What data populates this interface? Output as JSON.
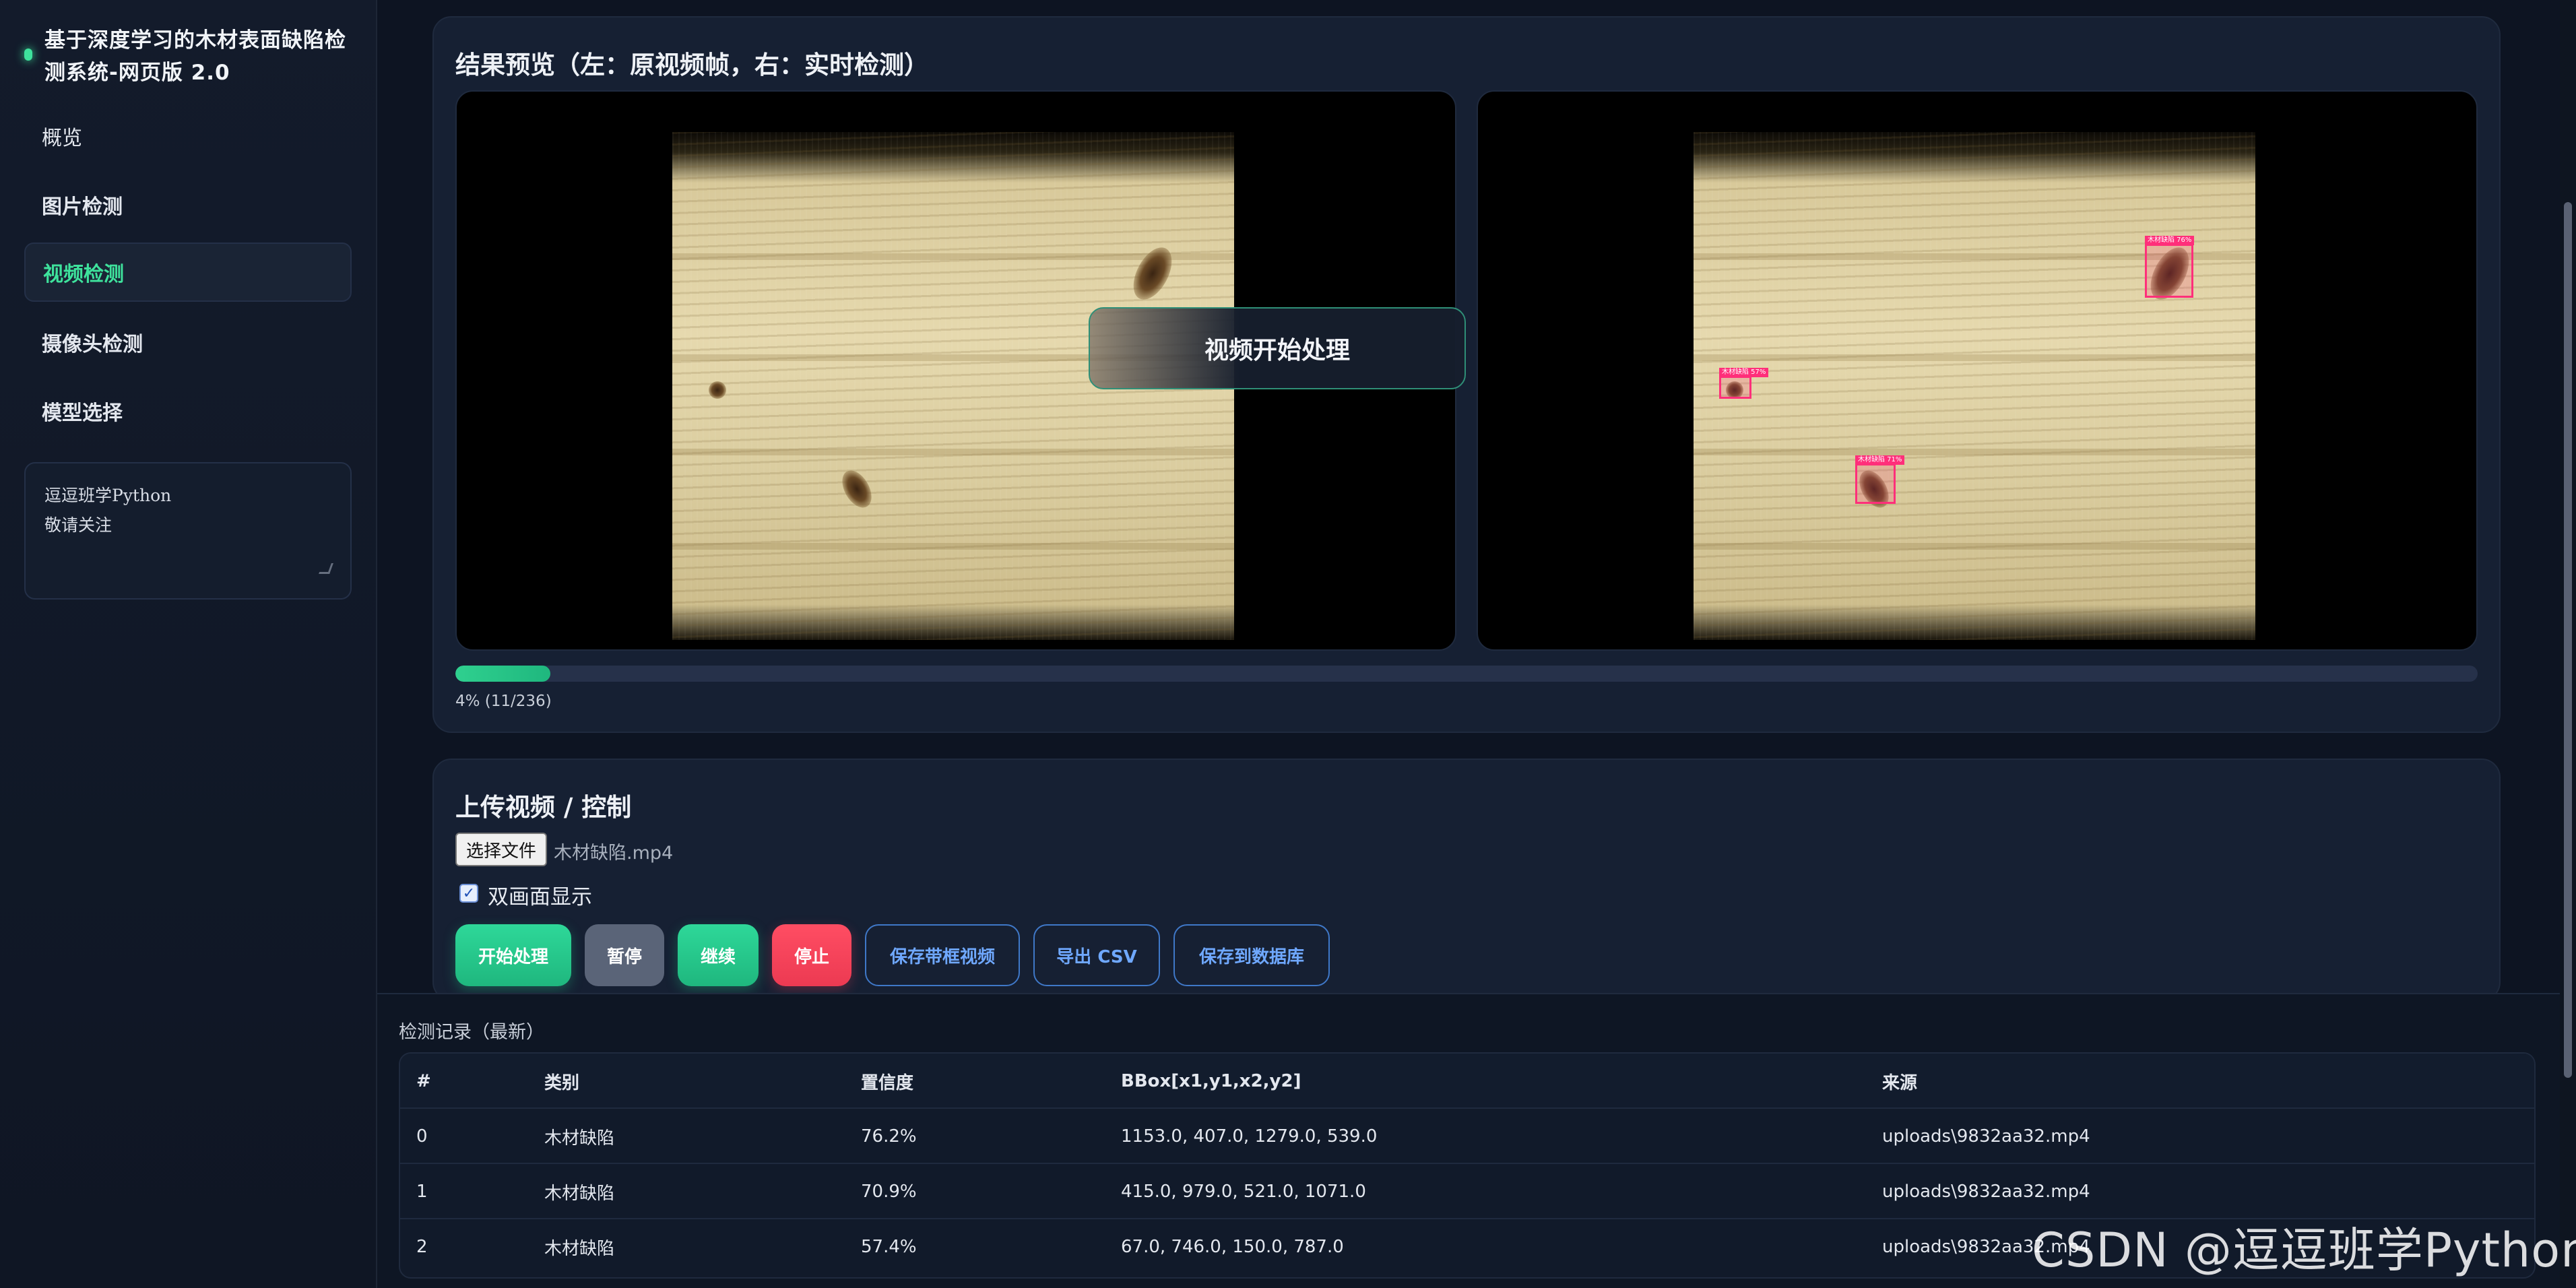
{
  "sidebar": {
    "brand": "基于深度学习的木材表面缺陷检测系统-网页版 2.0",
    "items": [
      {
        "label": "概览"
      },
      {
        "label": "图片检测"
      },
      {
        "label": "视频检测"
      },
      {
        "label": "摄像头检测"
      },
      {
        "label": "模型选择"
      }
    ],
    "notes": "逗逗班学Python\n敬请关注"
  },
  "preview": {
    "title": "结果预览（左：原视频帧，右：实时检测）",
    "overlay": "视频开始处理",
    "progress_fraction": 0.047,
    "progress_text": "4% (11/236)",
    "detections": [
      {
        "label": "木材缺陷 76%"
      },
      {
        "label": "木材缺陷 71%"
      },
      {
        "label": "木材缺陷 57%"
      }
    ]
  },
  "upload": {
    "title": "上传视频 / 控制",
    "choose_file": "选择文件",
    "file_name": "木材缺陷.mp4",
    "dual_view_label": "双画面显示",
    "dual_view_checked": true,
    "buttons": {
      "start": "开始处理",
      "pause": "暂停",
      "resume": "继续",
      "stop": "停止",
      "save_video": "保存带框视频",
      "export_csv": "导出 CSV",
      "save_db": "保存到数据库"
    }
  },
  "records": {
    "title": "检测记录（最新）",
    "columns": [
      "#",
      "类别",
      "置信度",
      "BBox[x1,y1,x2,y2]",
      "来源"
    ],
    "rows": [
      [
        "0",
        "木材缺陷",
        "76.2%",
        "1153.0, 407.0, 1279.0, 539.0",
        "uploads\\9832aa32.mp4"
      ],
      [
        "1",
        "木材缺陷",
        "70.9%",
        "415.0, 979.0, 521.0, 1071.0",
        "uploads\\9832aa32.mp4"
      ],
      [
        "2",
        "木材缺陷",
        "57.4%",
        "67.0, 746.0, 150.0, 787.0",
        "uploads\\9832aa32.mp4"
      ]
    ]
  },
  "watermark": "CSDN @逗逗班学Python",
  "colors": {
    "accent": "#3ee29c",
    "danger": "#ec3a52",
    "link": "#6fa8ff",
    "bg": "#0d1422"
  }
}
